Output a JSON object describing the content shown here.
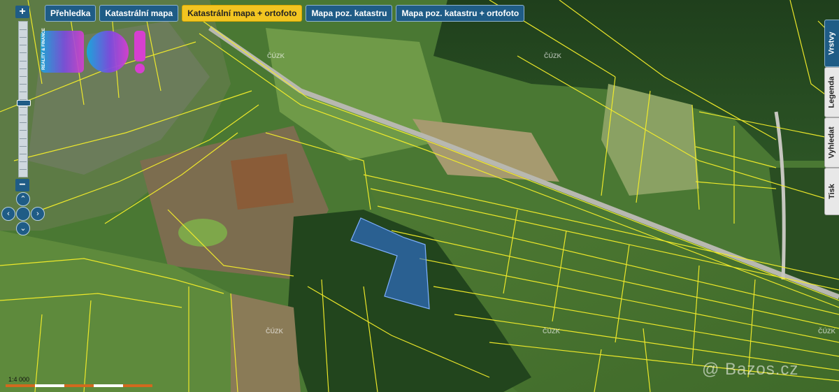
{
  "tabs": [
    {
      "label": "Přehledka"
    },
    {
      "label": "Katastrální mapa"
    },
    {
      "label": "Katastrální mapa + ortofoto"
    },
    {
      "label": "Mapa poz. katastru"
    },
    {
      "label": "Mapa poz. katastru + ortofoto"
    }
  ],
  "active_tab": "Katastrální mapa + ortofoto",
  "zoom": {
    "plus": "+",
    "minus": "−",
    "level": 0.52
  },
  "side_panel": [
    {
      "label": "Vrstvy"
    },
    {
      "label": "Legenda"
    },
    {
      "label": "Vyhledat"
    },
    {
      "label": "Tisk"
    }
  ],
  "logo": {
    "text": "BO!",
    "tagline": "REALITY & FINANCE"
  },
  "scale_label": "1:4 000",
  "watermark": "@ Bazos.cz",
  "cuzk_label": "ČÚZK",
  "colors": {
    "parcel_lines": "#f5ee2a",
    "highlight": "#2f6fd0",
    "tab_active": "#f2c521",
    "tab": "#1f5c86"
  }
}
